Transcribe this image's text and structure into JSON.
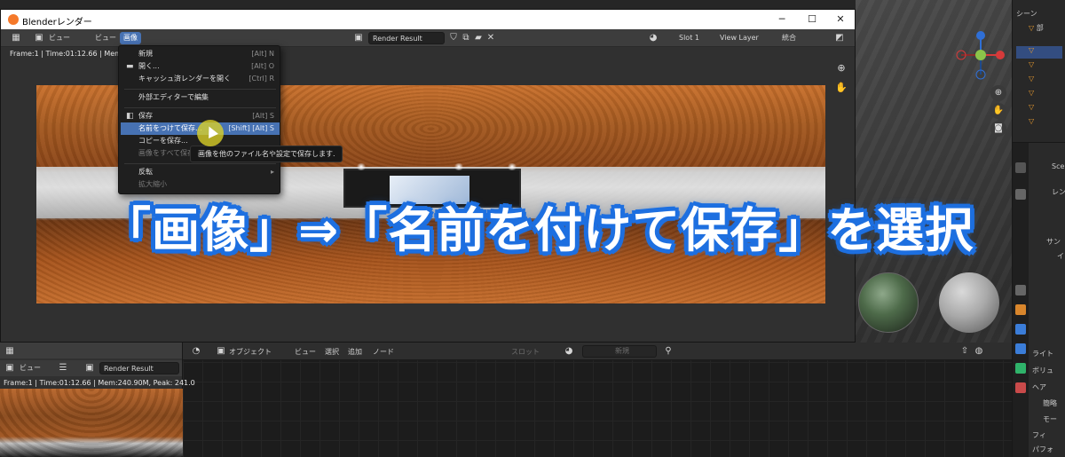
{
  "window": {
    "title": "Blenderレンダー",
    "minimize": "─",
    "maximize": "☐",
    "close": "✕"
  },
  "header": {
    "view_menu": "ビュー",
    "view_menu2": "ビュー",
    "image_menu": "画像",
    "image_name": "Render Result",
    "slot": "Slot 1",
    "view_layer": "View Layer",
    "pass": "統合"
  },
  "frame_info": "Frame:1 | Time:01:12.66 | Mem:2",
  "menu": {
    "items": [
      {
        "label": "新規",
        "shortcut": "[Alt] N",
        "icon": ""
      },
      {
        "label": "開く...",
        "shortcut": "[Alt] O",
        "icon": "▬"
      },
      {
        "label": "キャッシュ済レンダーを開く",
        "shortcut": "[Ctrl] R",
        "icon": ""
      },
      {
        "label": "外部エディターで編集",
        "shortcut": "",
        "icon": ""
      },
      {
        "label": "保存",
        "shortcut": "[Alt] S",
        "icon": "◧"
      },
      {
        "label": "名前をつけて保存...",
        "shortcut": "[Shift] [Alt] S",
        "icon": ""
      },
      {
        "label": "コピーを保存...",
        "shortcut": "",
        "icon": ""
      },
      {
        "label": "画像をすべて保存",
        "shortcut": "",
        "icon": ""
      },
      {
        "label": "反転",
        "shortcut": "▸",
        "icon": ""
      },
      {
        "label": "拡大縮小",
        "shortcut": "",
        "icon": ""
      }
    ]
  },
  "tooltip": "画像を他のファイル名や設定で保存します.",
  "caption": "「画像」⇒「名前を付けて保存」を選択",
  "bottom_left": {
    "view_menu": "ビュー",
    "image_name": "Render Result",
    "frame_info": "Frame:1 | Time:01:12.66 | Mem:240.90M, Peak: 241.0"
  },
  "node_editor": {
    "object_mode": "オブジェクト",
    "view": "ビュー",
    "select": "選択",
    "add": "追加",
    "node": "ノード",
    "slot": "スロット",
    "new": "新規"
  },
  "outliner": {
    "header": "シーン",
    "rows": [
      "部",
      "",
      "",
      "",
      "",
      "",
      "",
      ""
    ]
  },
  "properties": {
    "rows": [
      "Sce",
      "レン",
      "サン",
      "イ",
      "ライト",
      "ボリュ",
      "ヘア",
      "簡略",
      "モー",
      "フィ",
      "パフォ"
    ]
  },
  "colors": {
    "accent": "#4772b3",
    "caption_outline": "#1d6fe0",
    "cursor_highlight": "#dcd228"
  }
}
